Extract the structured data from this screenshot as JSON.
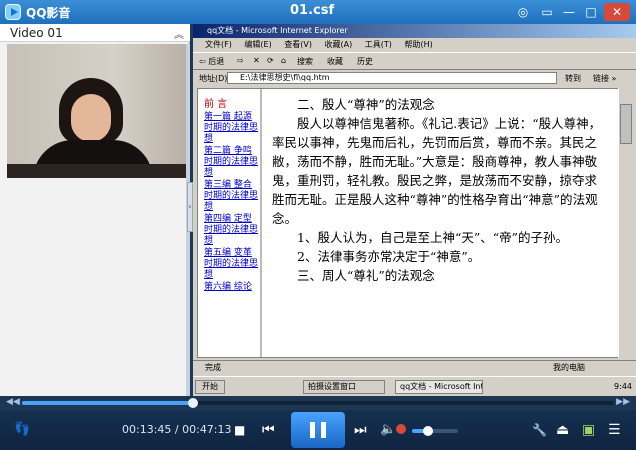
{
  "window": {
    "app_name": "QQ影音",
    "file_name": "01.csf",
    "buttons": {
      "skin": "◎",
      "menu": "▭",
      "minimize": "—",
      "maximize": "□",
      "close": "✕"
    }
  },
  "left_panel": {
    "label": "Video 01",
    "collapse_icon": "︽"
  },
  "ie_window": {
    "title": "qq文档 - Microsoft Internet Explorer",
    "menu": [
      "文件(F)",
      "编辑(E)",
      "查看(V)",
      "收藏(A)",
      "工具(T)",
      "帮助(H)"
    ],
    "toolbar": [
      "⇦ 后退",
      "⇨",
      "✕",
      "⟳",
      "⌂",
      "搜索",
      "收藏",
      "历史"
    ],
    "address_label": "地址(D)",
    "address_value": "E:\\法律思想史\\fl\\qq.htm",
    "go_label": "转到",
    "links_label": "链接 »",
    "status_left": "完成",
    "status_right": "我的电脑",
    "taskbar_start": "开始",
    "taskbar_tasks": [
      "拍摄设置窗口",
      "qq文档 - Microsoft Inter..."
    ],
    "clock": "9:44"
  },
  "nav": {
    "title": "前 言",
    "links": [
      "第一篇 起源时期的法律思想",
      "第二篇 争鸣时期的法律思想",
      "第三编 整合时期的法律思想",
      "第四编 定型时期的法律思想",
      "第五编 变革时期的法律思想",
      "第六编 综论"
    ]
  },
  "content": {
    "paragraphs": [
      "　　二、殷人“尊神”的法观念",
      "　　殷人以尊神信鬼著称。《礼记.表记》上说：“殷人尊神，率民以事神，先鬼而后礼，先罚而后赏，尊而不亲。其民之敝，荡而不静，胜而无耻。”大意是：殷商尊神，教人事神敬鬼，重刑罚，轻礼教。殷民之弊，是放荡而不安静，掠夺求胜而无耻。正是殷人这种“尊神”的性格孕育出“神意”的法观念。",
      "　　1、殷人认为，自己是至上神“天”、“帝”的子孙。",
      "　　2、法律事务亦常决定于“神意”。",
      "",
      "　　三、周人“尊礼”的法观念"
    ]
  },
  "seek": {
    "progress": 0.289,
    "back_icon": "◀◀",
    "fwd_icon": "▶▶"
  },
  "controls": {
    "current_time": "00:13:45",
    "separator": " / ",
    "total_time": "00:47:13",
    "volume": 0.35,
    "icons": {
      "feet": "👣",
      "stop": "■",
      "prev": "⏮",
      "next": "⏭",
      "volume": "🔈",
      "wrench": "🔧",
      "eject": "⏏",
      "screen": "▣",
      "list": "☰"
    }
  }
}
